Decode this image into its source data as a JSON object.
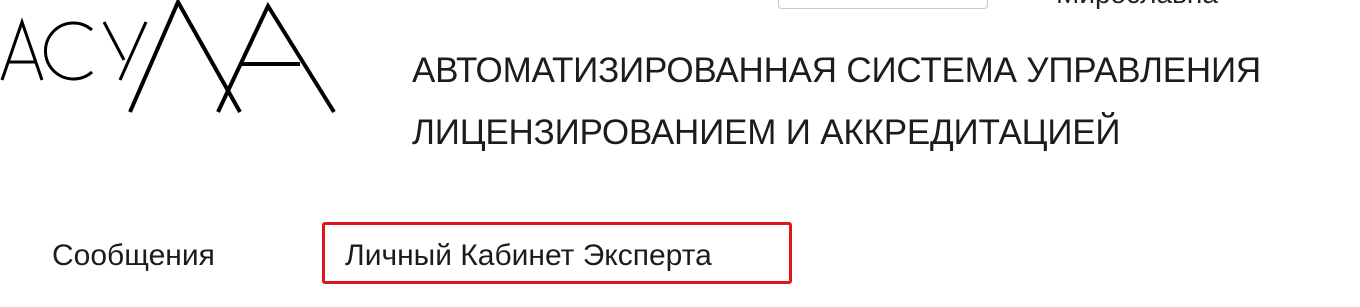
{
  "logo": {
    "text": "АСУЛА",
    "icon": "asula-logo-icon",
    "color": "#000000"
  },
  "header": {
    "user_name": "Мирославна",
    "system_title_line1": "АВТОМАТИЗИРОВАННАЯ СИСТЕМА УПРАВЛЕНИЯ",
    "system_title_line2": "ЛИЦЕНЗИРОВАНИЕМ И АККРЕДИТАЦИЕЙ"
  },
  "nav": {
    "items": [
      {
        "label": "Сообщения"
      },
      {
        "label": "Личный Кабинет Эксперта",
        "highlighted": true
      }
    ],
    "highlight_color": "#e0161d"
  }
}
